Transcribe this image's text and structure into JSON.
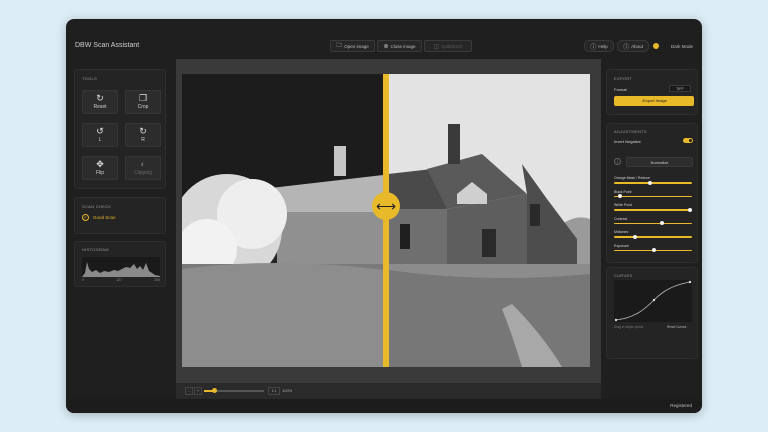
{
  "app": {
    "title": "DBW Scan Assistant"
  },
  "toolbar": {
    "open_label": "Open image",
    "close_label": "Close image",
    "split_label": "Split/Stitch",
    "help_label": "Help",
    "about_label": "About",
    "dark_mode_label": "Dark Mode"
  },
  "tools": {
    "title": "TOOLS",
    "items": [
      {
        "label": "Reset",
        "icon": "refresh-icon",
        "enabled": true
      },
      {
        "label": "Crop",
        "icon": "crop-icon",
        "enabled": true
      },
      {
        "label": "L",
        "icon": "rotate-left-icon",
        "enabled": true
      },
      {
        "label": "R",
        "icon": "rotate-right-icon",
        "enabled": true
      },
      {
        "label": "Flip",
        "icon": "flip-icon",
        "enabled": true
      },
      {
        "label": "Clipping",
        "icon": "clipping-icon",
        "enabled": false
      }
    ]
  },
  "scan_check": {
    "title": "SCAN CHECK",
    "status": "Good Scan"
  },
  "histogram": {
    "title": "HISTOGRAM",
    "ticks": [
      "0",
      "127",
      "255"
    ]
  },
  "zoom": {
    "minus": "-",
    "plus": "+",
    "fit": "1:1",
    "percent": "100%",
    "level": 0.18
  },
  "export": {
    "title": "EXPORT",
    "format_label": "Format",
    "format_value": "TIFF",
    "button_label": "Export Image"
  },
  "adjustments": {
    "title": "ADJUSTMENTS",
    "invert_label": "Invert Negative",
    "invert_on": true,
    "preset": "Normalize",
    "sliders": [
      {
        "label": "Orange Mask / Reduce",
        "value": 0.45
      },
      {
        "label": "Black Point",
        "value": 0.05
      },
      {
        "label": "White Point",
        "value": 0.98
      },
      {
        "label": "Contrast",
        "value": 0.6
      },
      {
        "label": "Midtones",
        "value": 0.25
      },
      {
        "label": "Exposure",
        "value": 0.5
      }
    ]
  },
  "curves": {
    "title": "CURVES",
    "hint": "Drag to adjust points",
    "reset_label": "Reset Curves"
  },
  "status": {
    "text": "Registered"
  },
  "colors": {
    "accent": "#e8b928",
    "panel": "#242424",
    "background": "#dcedf6"
  }
}
